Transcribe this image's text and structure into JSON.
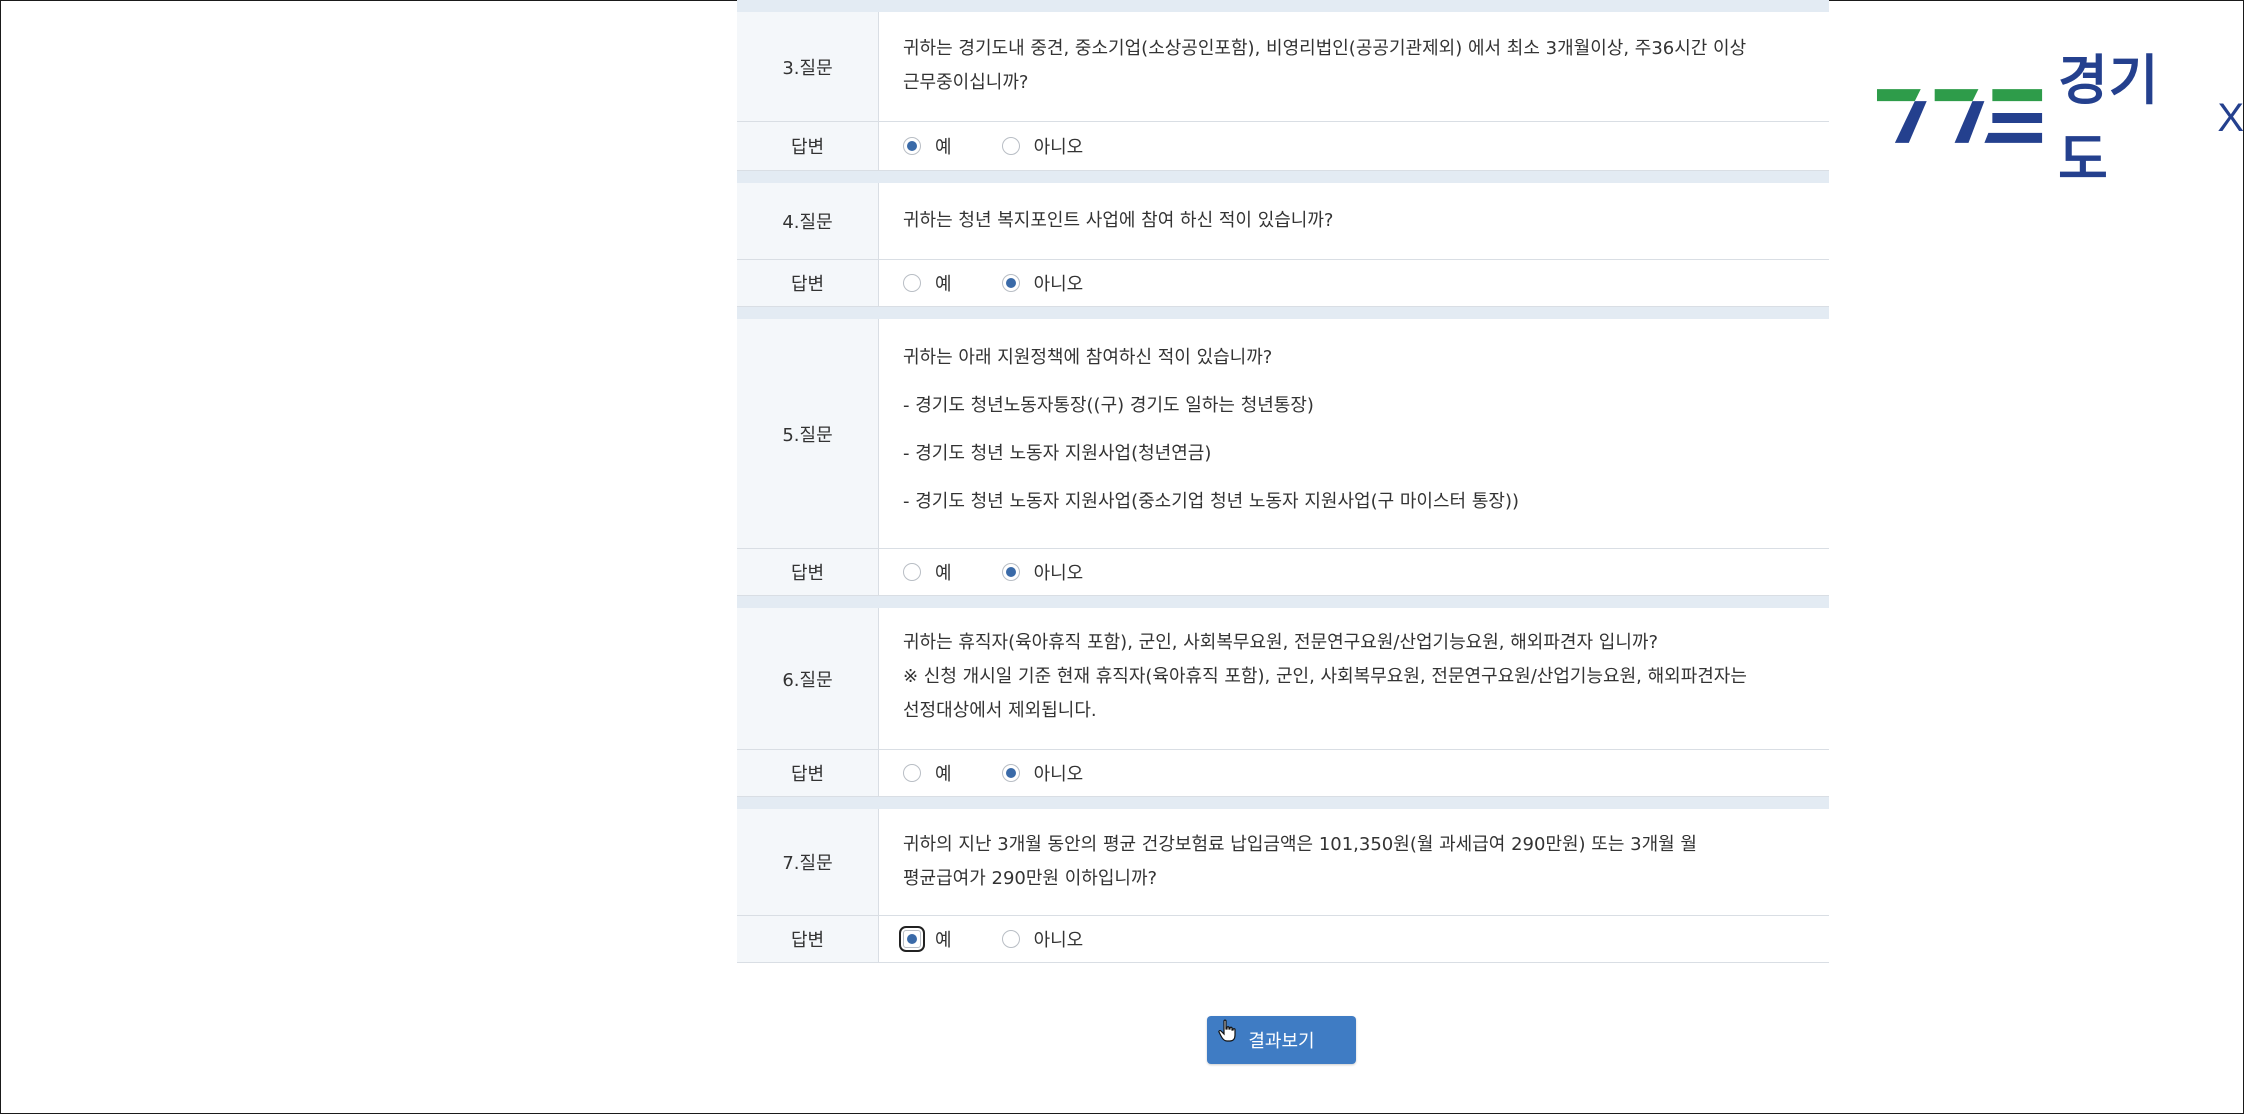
{
  "survey": {
    "questions": [
      {
        "label": "3.질문",
        "lines": [
          "귀하는 경기도내 중견, 중소기업(소상공인포함), 비영리법인(공공기관제외) 에서 최소 3개월이상, 주36시간 이상",
          "근무중이십니까?"
        ],
        "answer_label": "답변",
        "yes": "예",
        "no": "아니오",
        "selected": "yes"
      },
      {
        "label": "4.질문",
        "lines": [
          "귀하는 청년 복지포인트 사업에 참여 하신 적이 있습니까?"
        ],
        "answer_label": "답변",
        "yes": "예",
        "no": "아니오",
        "selected": "no"
      },
      {
        "label": "5.질문",
        "lines": [
          "귀하는 아래 지원정책에 참여하신 적이 있습니까?",
          "- 경기도 청년노동자통장((구) 경기도 일하는 청년통장)",
          "- 경기도 청년 노동자 지원사업(청년연금)",
          "- 경기도 청년 노동자 지원사업(중소기업 청년 노동자 지원사업(구 마이스터 통장))"
        ],
        "answer_label": "답변",
        "yes": "예",
        "no": "아니오",
        "selected": "no"
      },
      {
        "label": "6.질문",
        "lines": [
          "귀하는 휴직자(육아휴직 포함), 군인, 사회복무요원, 전문연구요원/산업기능요원, 해외파견자 입니까?",
          "※ 신청 개시일 기준 현재 휴직자(육아휴직 포함), 군인, 사회복무요원, 전문연구요원/산업기능요원, 해외파견자는",
          "선정대상에서 제외됩니다."
        ],
        "answer_label": "답변",
        "yes": "예",
        "no": "아니오",
        "selected": "no"
      },
      {
        "label": "7.질문",
        "lines": [
          "귀하의 지난 3개월 동안의 평균 건강보험료 납입금액은 101,350원(월 과세급여 290만원) 또는 3개월 월",
          "평균급여가 290만원 이하입니까?"
        ],
        "answer_label": "답변",
        "yes": "예",
        "no": "아니오",
        "selected": "yes"
      }
    ]
  },
  "result_button": "결과보기",
  "logo": {
    "text": "경기도",
    "suffix": "X",
    "icon": "gyeonggi-emblem-icon"
  },
  "colors": {
    "accent": "#3f7cc4",
    "brand_navy": "#24408e",
    "brand_green": "#2e9c4a",
    "separator": "#e3ebf3"
  }
}
